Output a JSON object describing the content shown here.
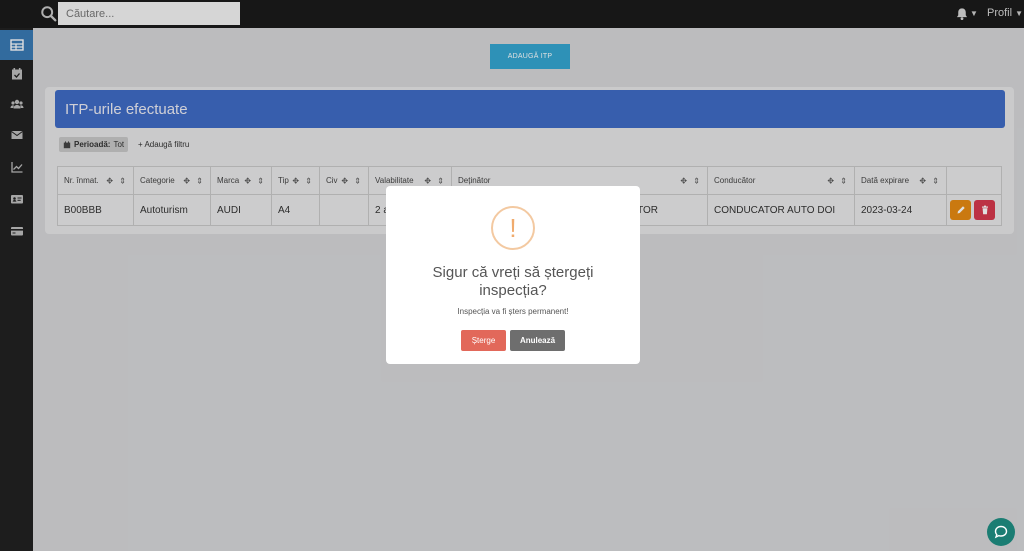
{
  "topbar": {
    "search_placeholder": "Căutare...",
    "profile_label": "Profil",
    "caret": "▼"
  },
  "sidebar": {
    "items": [
      "table-icon",
      "calendar-check-icon",
      "users-icon",
      "envelope-icon",
      "chart-line-icon",
      "id-card-icon",
      "credit-card-icon"
    ]
  },
  "main": {
    "add_button": "ADAUGĂ ITP",
    "panel_title": "ITP-urile efectuate",
    "filter_label": "Perioadă:",
    "filter_value": "Tot",
    "add_filter": "+ Adaugă filtru"
  },
  "table": {
    "columns": [
      "Nr. înmat.",
      "Categorie",
      "Marca",
      "Tip",
      "Civ",
      "Valabilitate",
      "Deținător",
      "Conducător",
      "Dată expirare"
    ],
    "rows": [
      [
        "B00BBB",
        "Autoturism",
        "AUDI",
        "A4",
        "",
        "2 a",
        "ATOR",
        "CONDUCATOR AUTO DOI",
        "2023-03-24"
      ]
    ]
  },
  "modal": {
    "icon": "!",
    "title_line1": "Sigur că vreți să ștergeți",
    "title_line2": "inspecția?",
    "text": "Inspecția va fi șters permanent!",
    "confirm": "Șterge",
    "cancel": "Anulează"
  },
  "colors": {
    "accent": "#3f6cc5",
    "topbar": "#1b1b1b",
    "sidebar": "#222222",
    "danger": "#e2685a",
    "warning": "#f0ab6d",
    "edit": "#e68a13",
    "delete": "#d63a4e",
    "chat": "#1b7d73"
  }
}
